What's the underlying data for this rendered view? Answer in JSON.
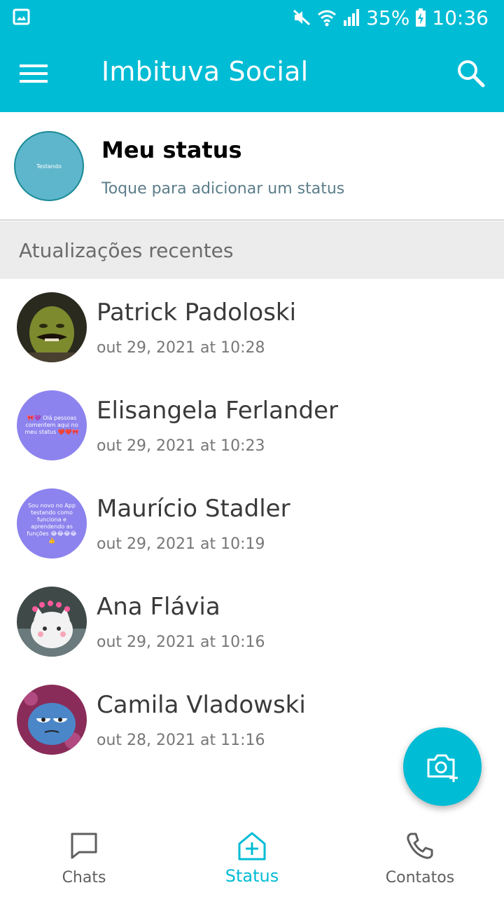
{
  "colors": {
    "primary": "#00BCD4",
    "text_dark": "#3a3a3a",
    "text_muted": "#777777",
    "section_bg": "#ececec"
  },
  "status_bar": {
    "battery": "35%",
    "time": "10:36"
  },
  "app_bar": {
    "title": "Imbituva Social",
    "menu_icon": "menu-icon",
    "search_icon": "search-icon"
  },
  "my_status": {
    "avatar_text": "Testando",
    "title": "Meu status",
    "subtitle": "Toque para adicionar um status"
  },
  "section": {
    "title": "Atualizações recentes"
  },
  "updates": [
    {
      "name": "Patrick Padoloski",
      "time": "out 29, 2021 at 10:28"
    },
    {
      "name": "Elisangela Ferlander",
      "time": "out 29, 2021 at 10:23",
      "avatar_text": "🎀💜 Olá pessoas comentem aqui no meu status ❤️❤️🎀"
    },
    {
      "name": "Maurício Stadler",
      "time": "out 29, 2021 at 10:19",
      "avatar_text": "Sou novo no App testando como funciona e aprendendo as funções 😂😂😂😂👍"
    },
    {
      "name": "Ana Flávia",
      "time": "out 29, 2021 at 10:16"
    },
    {
      "name": "Camila Vladowski",
      "time": "out 28, 2021 at 11:16"
    }
  ],
  "fab": {
    "icon": "camera-add-icon"
  },
  "bottom_nav": [
    {
      "label": "Chats",
      "icon": "chat-icon"
    },
    {
      "label": "Status",
      "icon": "status-add-icon",
      "active": true
    },
    {
      "label": "Contatos",
      "icon": "phone-icon"
    }
  ]
}
